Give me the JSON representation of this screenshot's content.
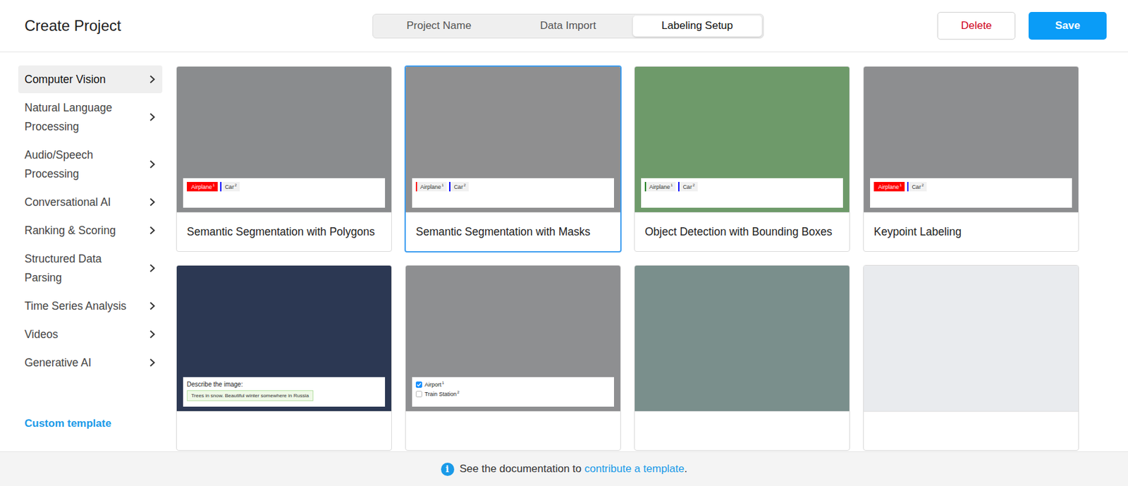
{
  "header": {
    "title": "Create Project",
    "tabs": [
      {
        "label": "Project Name",
        "selected": false
      },
      {
        "label": "Data Import",
        "selected": false
      },
      {
        "label": "Labeling Setup",
        "selected": true
      }
    ],
    "buttons": {
      "delete": "Delete",
      "save": "Save"
    }
  },
  "sidebar": {
    "items": [
      {
        "label": "Computer Vision",
        "selected": true
      },
      {
        "label": "Natural Language Processing",
        "selected": false
      },
      {
        "label": "Audio/Speech Processing",
        "selected": false
      },
      {
        "label": "Conversational AI",
        "selected": false
      },
      {
        "label": "Ranking & Scoring",
        "selected": false
      },
      {
        "label": "Structured Data Parsing",
        "selected": false
      },
      {
        "label": "Time Series Analysis",
        "selected": false
      },
      {
        "label": "Videos",
        "selected": false
      },
      {
        "label": "Generative AI",
        "selected": false
      }
    ],
    "custom_template": "Custom template"
  },
  "templates": [
    {
      "title": "Semantic Segmentation with Polygons",
      "selected": false,
      "color": "#8a8c8e",
      "kind": "labels",
      "labels": [
        {
          "text": "Airplane",
          "hotkey": "1",
          "color": "#ff0000",
          "selected": true
        },
        {
          "text": "Car",
          "hotkey": "2",
          "color": "#0000ff",
          "selected": false
        }
      ]
    },
    {
      "title": "Semantic Segmentation with Masks",
      "selected": true,
      "color": "#8f8f90",
      "kind": "labels",
      "labels": [
        {
          "text": "Airplane",
          "hotkey": "1",
          "color": "#ff0000",
          "selected": false
        },
        {
          "text": "Car",
          "hotkey": "2",
          "color": "#0000ff",
          "selected": false
        }
      ]
    },
    {
      "title": "Object Detection with Bounding Boxes",
      "selected": false,
      "color": "#6e9a6a",
      "kind": "labels",
      "labels": [
        {
          "text": "Airplane",
          "hotkey": "1",
          "color": "#008000",
          "selected": false
        },
        {
          "text": "Car",
          "hotkey": "2",
          "color": "#0000ff",
          "selected": false
        }
      ]
    },
    {
      "title": "Keypoint Labeling",
      "selected": false,
      "color": "#8d8e90",
      "kind": "labels",
      "labels": [
        {
          "text": "Airplane",
          "hotkey": "1",
          "color": "#ff0000",
          "selected": true
        },
        {
          "text": "Car",
          "hotkey": "2",
          "color": "#0000ff",
          "selected": false
        }
      ]
    },
    {
      "title": "",
      "selected": false,
      "color": "#2c3853",
      "kind": "textarea",
      "prompt": "Describe the image:",
      "answer": "Trees in snow. Beautiful winter somewhere in Russia"
    },
    {
      "title": "",
      "selected": false,
      "color": "#8e8f91",
      "kind": "choices",
      "choices": [
        {
          "text": "Airport",
          "hotkey": "1",
          "checked": true
        },
        {
          "text": "Train Station",
          "hotkey": "2",
          "checked": false
        }
      ]
    },
    {
      "title": "",
      "selected": false,
      "color": "#7a8f8c",
      "kind": "plain"
    },
    {
      "title": "",
      "selected": false,
      "color": "#e9ebee",
      "kind": "plain"
    }
  ],
  "footer": {
    "icon": "i",
    "text": "See the documentation to",
    "link": "contribute a template",
    "end": "."
  }
}
